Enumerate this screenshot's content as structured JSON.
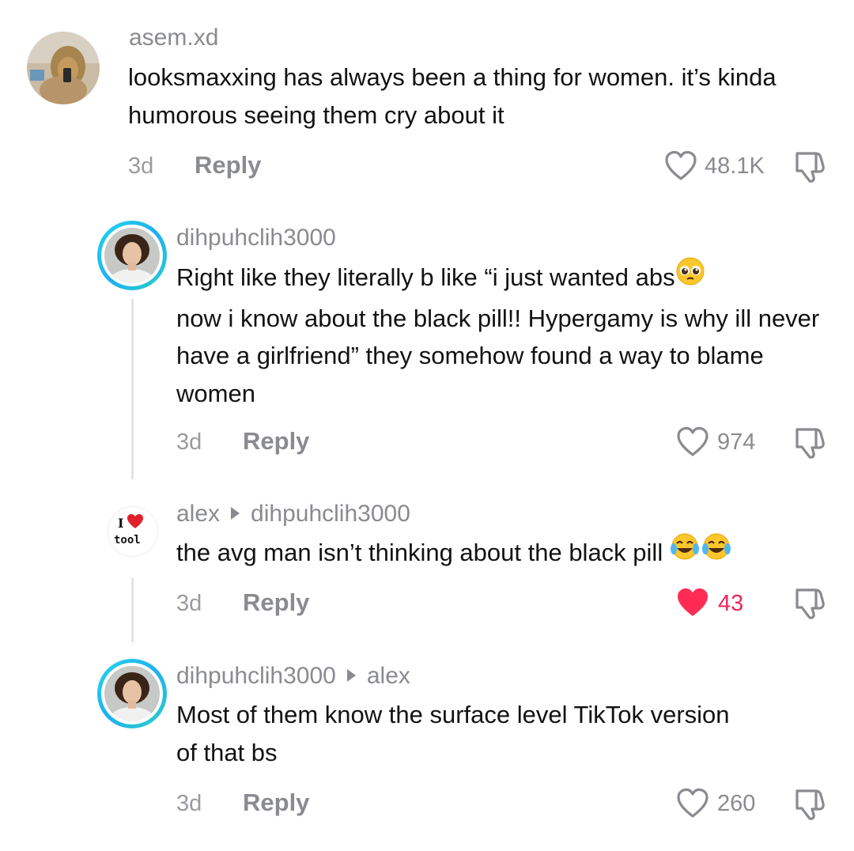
{
  "comments": [
    {
      "username": "asem.xd",
      "text": "looksmaxxing has always been a thing for women. it’s kinda humorous seeing them cry about it",
      "time": "3d",
      "reply_label": "Reply",
      "likes": "48.1K",
      "liked": false,
      "avatar_icon": "lion-photo-avatar"
    },
    {
      "username": "dihpuhclih3000",
      "text_line1": "Right like they literally b like “i just wanted abs",
      "text_line1_emoji": "pleading-face-emoji",
      "text_rest": "now i know about the black pill!! Hypergamy is why ill never have a girlfriend” they somehow found a way to blame women",
      "time": "3d",
      "reply_label": "Reply",
      "likes": "974",
      "liked": false,
      "avatar_icon": "woman-portrait-avatar"
    },
    {
      "username": "alex",
      "reply_to": "dihpuhclih3000",
      "text": "the avg man isn’t thinking about the black pill",
      "text_emoji": "laughing-tears-emoji",
      "time": "3d",
      "reply_label": "Reply",
      "likes": "43",
      "liked": true,
      "avatar_icon": "i-love-tool-avatar",
      "avatar_text_top": "I",
      "avatar_text_bottom": "tool"
    },
    {
      "username": "dihpuhclih3000",
      "reply_to": "alex",
      "text": "Most of them know the surface level TikTok version of that bs",
      "time": "3d",
      "reply_label": "Reply",
      "likes": "260",
      "liked": false,
      "avatar_icon": "woman-portrait-avatar"
    }
  ],
  "colors": {
    "like_active": "#fe2c55",
    "muted_text": "#8a8b91",
    "ring_gradient": "#25d6e8"
  }
}
